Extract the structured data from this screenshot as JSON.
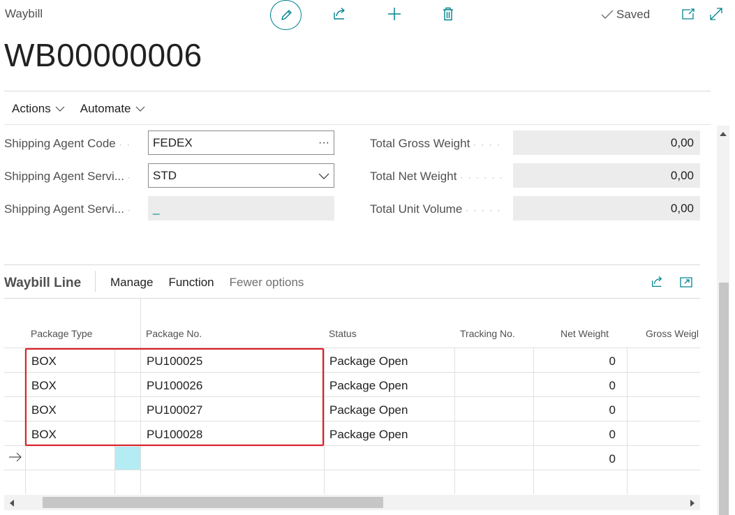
{
  "header": {
    "caption": "Waybill",
    "title": "WB00000006",
    "saved_label": "Saved",
    "accent_color": "#00838f"
  },
  "actions": {
    "actions_label": "Actions",
    "automate_label": "Automate"
  },
  "fields_left": [
    {
      "label": "Shipping Agent Code",
      "value": "FEDEX",
      "type": "lookup"
    },
    {
      "label": "Shipping Agent Servi...",
      "value": "STD",
      "type": "dropdown"
    },
    {
      "label": "Shipping Agent Servi...",
      "value": "_",
      "type": "readonly"
    }
  ],
  "fields_right": [
    {
      "label": "Total Gross Weight",
      "value": "0,00"
    },
    {
      "label": "Total Net Weight",
      "value": "0,00"
    },
    {
      "label": "Total Unit Volume",
      "value": "0,00"
    }
  ],
  "lines": {
    "title": "Waybill Line",
    "menu": [
      "Manage",
      "Function",
      "Fewer options"
    ],
    "columns": [
      "Package Type",
      "Package No.",
      "Status",
      "Tracking No.",
      "Net Weight",
      "Gross Weigl"
    ],
    "rows": [
      {
        "package_type": "BOX",
        "package_no": "PU100025",
        "status": "Package Open",
        "tracking_no": "",
        "net_weight": "0"
      },
      {
        "package_type": "BOX",
        "package_no": "PU100026",
        "status": "Package Open",
        "tracking_no": "",
        "net_weight": "0"
      },
      {
        "package_type": "BOX",
        "package_no": "PU100027",
        "status": "Package Open",
        "tracking_no": "",
        "net_weight": "0"
      },
      {
        "package_type": "BOX",
        "package_no": "PU100028",
        "status": "Package Open",
        "tracking_no": "",
        "net_weight": "0"
      }
    ],
    "new_row": {
      "net_weight": "0"
    },
    "highlight_color": "#d61f26"
  }
}
